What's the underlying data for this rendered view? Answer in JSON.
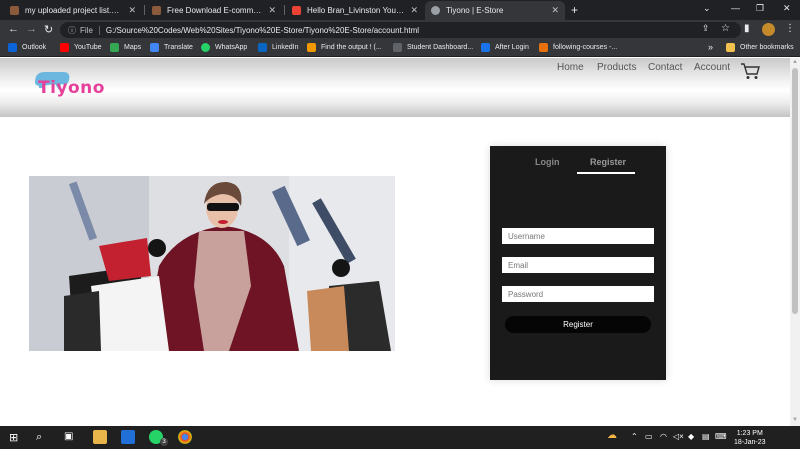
{
  "browser": {
    "tabs": [
      {
        "title": "my uploaded project list.downlo",
        "favicon_color": "#8a5a3a"
      },
      {
        "title": "Free Download E-commerce Web",
        "favicon_color": "#8a5a3a"
      },
      {
        "title": "Hello Bran_Livinston Your kaship",
        "favicon_color": "#ea4335"
      },
      {
        "title": "Tiyono | E-Store",
        "favicon_color": "#9aa0a6"
      }
    ],
    "new_tab": "+",
    "window_controls": [
      "⌄",
      "—",
      "❐",
      "✕"
    ],
    "omnibox": {
      "scheme": "File",
      "url": "G:/Source%20Codes/Web%20Sites/Tiyono%20E-Store/Tiyono%20E-Store/account.html"
    },
    "bookmarks": [
      {
        "label": "Outlook",
        "color": "#0a64d8"
      },
      {
        "label": "YouTube",
        "color": "#ff0000"
      },
      {
        "label": "Maps",
        "color": "#34a853"
      },
      {
        "label": "Translate",
        "color": "#4285f4"
      },
      {
        "label": "WhatsApp",
        "color": "#25d366"
      },
      {
        "label": "LinkedIn",
        "color": "#0a66c2"
      },
      {
        "label": "Find the output ! (...",
        "color": "#f29900"
      },
      {
        "label": "Student Dashboard...",
        "color": "#5f6368"
      },
      {
        "label": "After Login",
        "color": "#1a73e8"
      },
      {
        "label": "following-courses -...",
        "color": "#e8710a"
      }
    ],
    "bookmarks_overflow": "»",
    "other_bookmarks": "Other bookmarks"
  },
  "site": {
    "logo_text": "Tiyono",
    "nav": [
      "Home",
      "Products",
      "Contact",
      "Account"
    ],
    "form": {
      "login_tab": "Login",
      "register_tab": "Register",
      "username_placeholder": "Username",
      "email_placeholder": "Email",
      "password_placeholder": "Password",
      "register_button": "Register"
    }
  },
  "taskbar": {
    "time": "1:23 PM",
    "date": "18-Jan-23",
    "whatsapp_badge": "3"
  }
}
